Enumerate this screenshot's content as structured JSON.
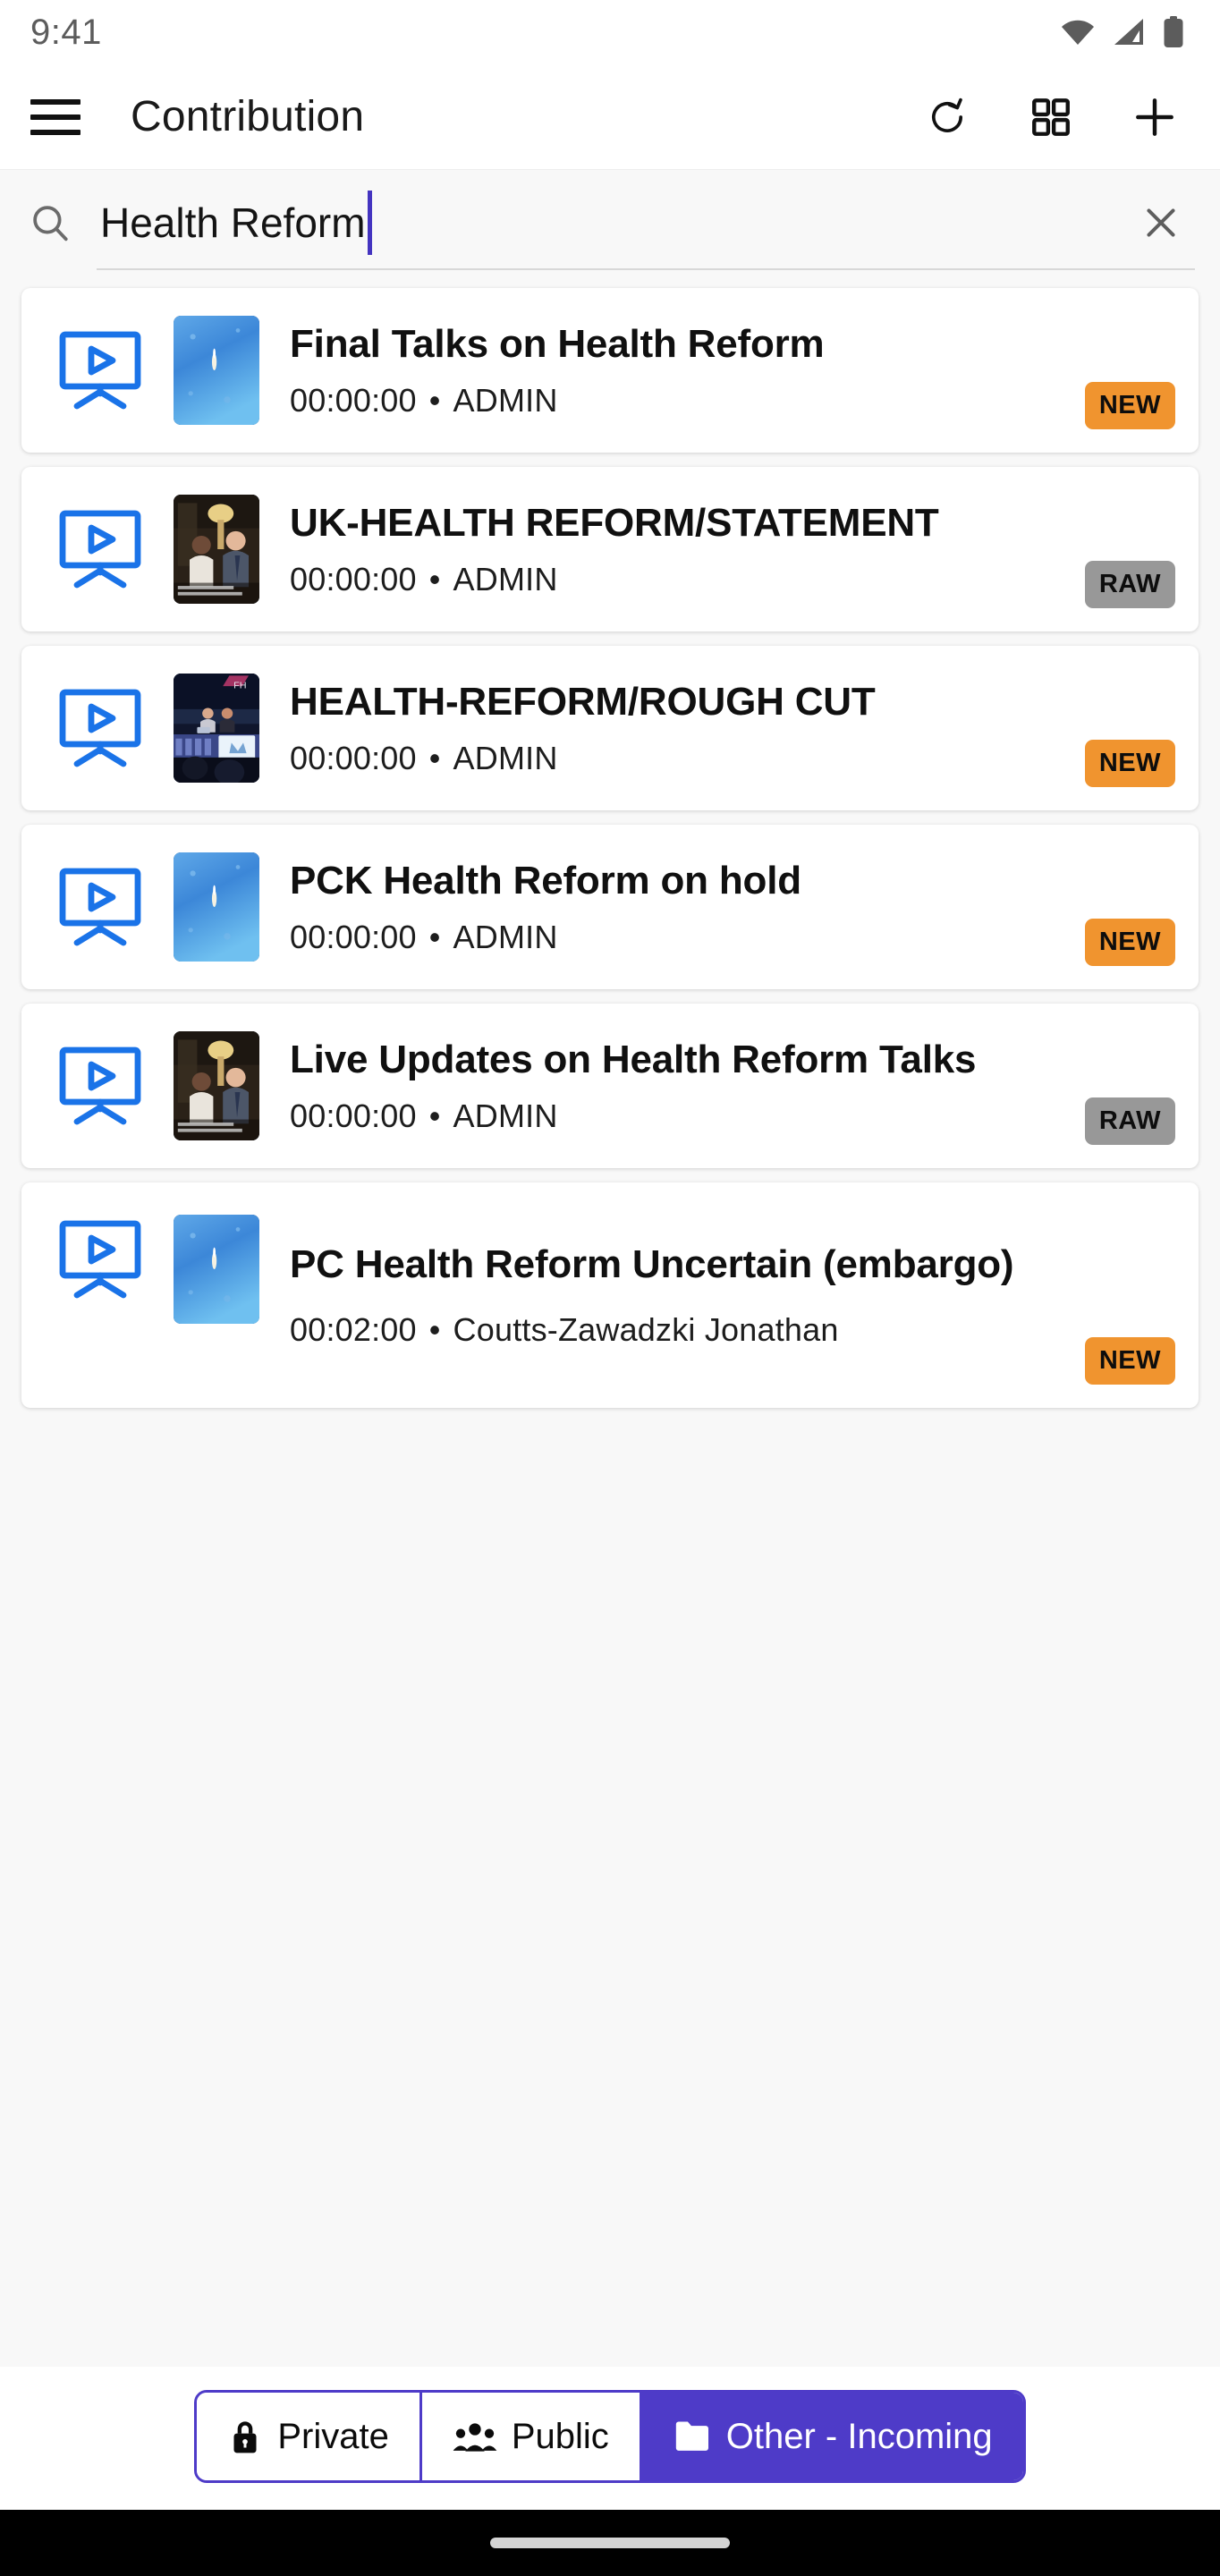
{
  "status_bar": {
    "time": "9:41",
    "icons": [
      "wifi-icon",
      "cellular-signal-icon",
      "battery-icon"
    ]
  },
  "app_bar": {
    "menu_icon": "hamburger-menu-icon",
    "title": "Contribution",
    "actions": [
      {
        "name": "refresh-icon",
        "label": "Refresh"
      },
      {
        "name": "grid-view-icon",
        "label": "Grid view"
      },
      {
        "name": "add-icon",
        "label": "Add"
      }
    ]
  },
  "search": {
    "icon": "search-icon",
    "value": "Health Reform",
    "placeholder": "Search",
    "clear_icon": "close-icon",
    "caret_color": "#4434c0"
  },
  "list": {
    "items": [
      {
        "title": "Final Talks on Health Reform",
        "duration": "00:00:00",
        "separator": "•",
        "owner": "ADMIN",
        "badge": "NEW",
        "badge_type": "new",
        "thumbnail": "sky-rocket-launch-thumbnail",
        "type_icon": "video-monitor-play-icon"
      },
      {
        "title": "UK-HEALTH REFORM/STATEMENT",
        "duration": "00:00:00",
        "separator": "•",
        "owner": "ADMIN",
        "badge": "RAW",
        "badge_type": "raw",
        "thumbnail": "interview-room-thumbnail",
        "type_icon": "video-monitor-play-icon"
      },
      {
        "title": "HEALTH-REFORM/ROUGH CUT",
        "duration": "00:00:00",
        "separator": "•",
        "owner": "ADMIN",
        "badge": "NEW",
        "badge_type": "new",
        "thumbnail": "news-studio-thumbnail",
        "type_icon": "video-monitor-play-icon"
      },
      {
        "title": "PCK Health Reform on hold",
        "duration": "00:00:00",
        "separator": "•",
        "owner": "ADMIN",
        "badge": "NEW",
        "badge_type": "new",
        "thumbnail": "sky-rocket-launch-thumbnail",
        "type_icon": "video-monitor-play-icon"
      },
      {
        "title": "Live Updates on Health Reform Talks",
        "duration": "00:00:00",
        "separator": "•",
        "owner": "ADMIN",
        "badge": "RAW",
        "badge_type": "raw",
        "thumbnail": "interview-room-thumbnail",
        "type_icon": "video-monitor-play-icon"
      },
      {
        "title": "PC Health Reform Uncertain (embargo)",
        "duration": "00:02:00",
        "separator": "•",
        "owner": "Coutts-Zawadzki Jonathan",
        "badge": "NEW",
        "badge_type": "new",
        "thumbnail": "sky-rocket-launch-thumbnail",
        "type_icon": "video-monitor-play-icon"
      }
    ]
  },
  "bottom_nav": {
    "items": [
      {
        "label": "Private",
        "icon": "lock-icon",
        "active": false
      },
      {
        "label": "Public",
        "icon": "people-group-icon",
        "active": false
      },
      {
        "label": "Other - Incoming",
        "icon": "folder-icon",
        "active": true
      }
    ]
  },
  "colors": {
    "accent_purple": "#4e3bc8",
    "badge_new": "#f0942f",
    "badge_raw": "#989898",
    "icon_blue": "#1a73e8",
    "page_background": "#f8f8f8"
  }
}
